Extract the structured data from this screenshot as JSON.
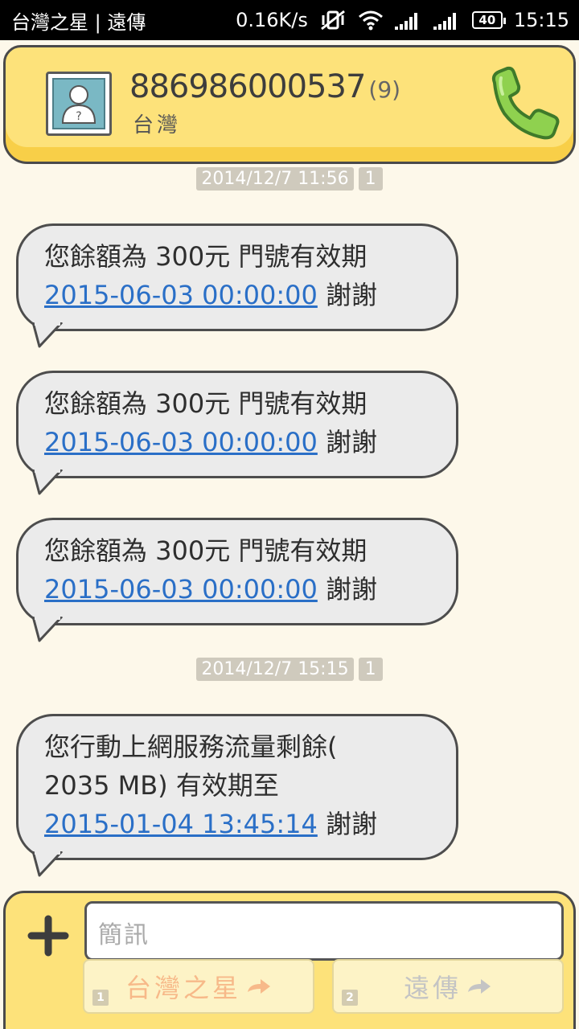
{
  "status_bar": {
    "carriers": "台灣之星 | 遠傳",
    "speed": "0.16K/s",
    "battery": "40",
    "time": "15:15"
  },
  "header": {
    "number": "886986000537",
    "count": "(9)",
    "region": "台灣"
  },
  "messages": [
    {
      "date": "2014/12/7  11:56",
      "sim": "1"
    },
    {
      "line1": "您餘額為 300元 門號有效期",
      "link": "2015-06-03 00:00:00",
      "suffix": " 謝謝"
    },
    {
      "line1": "您餘額為 300元 門號有效期",
      "link": "2015-06-03 00:00:00",
      "suffix": " 謝謝"
    },
    {
      "line1": "您餘額為 300元 門號有效期",
      "link": "2015-06-03 00:00:00",
      "suffix": " 謝謝"
    },
    {
      "date": "2014/12/7  15:15",
      "sim": "1"
    },
    {
      "line1": "您行動上網服務流量剩餘(",
      "line2": "2035 MB) 有效期至",
      "link": "2015-01-04 13:45:14",
      "suffix": " 謝謝"
    }
  ],
  "compose": {
    "placeholder": "簡訊",
    "send_sim1_label": "台灣之星",
    "send_sim1_slot": "1",
    "send_sim2_label": "遠傳",
    "send_sim2_slot": "2"
  },
  "colors": {
    "header_bg": "#fde27a",
    "bubble_bg": "#ebebeb",
    "link": "#2a6fc7",
    "call_green": "#8fd14f"
  },
  "icons": {
    "wifi": "wifi-icon",
    "mute": "vibrate-off-icon",
    "signal": "signal-icon",
    "call": "phone-icon",
    "add": "plus-icon",
    "send": "arrow-right-icon"
  }
}
